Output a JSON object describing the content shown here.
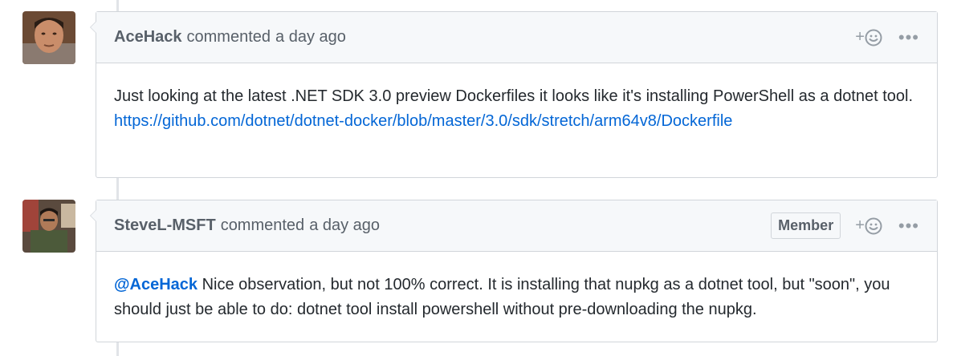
{
  "comments": [
    {
      "author": "AceHack",
      "verb": "commented",
      "time": "a day ago",
      "badge": "",
      "body_text": "Just looking at the latest .NET SDK 3.0 preview Dockerfiles it looks like it's installing PowerShell as a dotnet tool.",
      "body_link": "https://github.com/dotnet/dotnet-docker/blob/master/3.0/sdk/stretch/arm64v8/Dockerfile"
    },
    {
      "author": "SteveL-MSFT",
      "verb": "commented",
      "time": "a day ago",
      "badge": "Member",
      "mention": "@AceHack",
      "body_text": "Nice observation, but not 100% correct. It is installing that nupkg as a dotnet tool, but \"soon\", you should just be able to do: dotnet tool install powershell without pre-downloading the nupkg."
    }
  ],
  "actions": {
    "reaction_plus": "+",
    "more": "•••"
  },
  "icons": {
    "reaction": "smiley-icon",
    "more": "kebab-horizontal-icon"
  },
  "colors": {
    "link": "#0366d6",
    "header_bg": "#f6f8fa",
    "border": "#d1d5da",
    "muted": "#586069"
  }
}
